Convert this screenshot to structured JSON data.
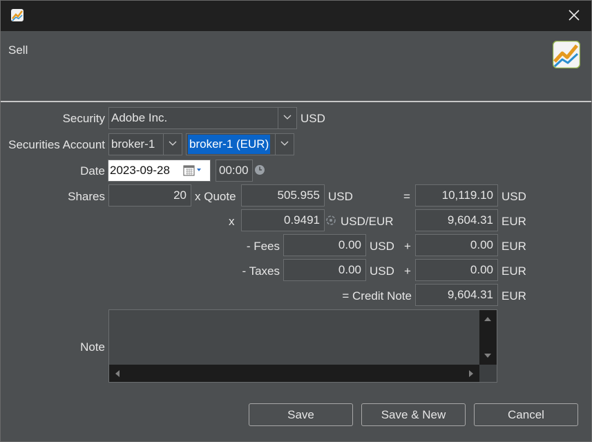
{
  "dialog": {
    "title": "Sell"
  },
  "form": {
    "security": {
      "label": "Security",
      "value": "Adobe Inc.",
      "currency": "USD"
    },
    "account": {
      "label": "Securities Account",
      "securities_value": "broker-1",
      "cash_value": "broker-1 (EUR)"
    },
    "date": {
      "label": "Date",
      "value": "2023-09-28",
      "time": "00:00"
    },
    "shares": {
      "label": "Shares",
      "value": "20"
    },
    "quote": {
      "label": "x Quote",
      "value": "505.955",
      "currency": "USD"
    },
    "gross": {
      "eq": "=",
      "value": "10,119.10",
      "currency": "USD"
    },
    "exchange": {
      "x": "x",
      "rate": "0.9491",
      "pair": "USD/EUR",
      "converted": "9,604.31",
      "currency": "EUR"
    },
    "fees": {
      "label": "- Fees",
      "value": "0.00",
      "currency": "USD",
      "plus": "+",
      "converted": "0.00",
      "converted_currency": "EUR"
    },
    "taxes": {
      "label": "- Taxes",
      "value": "0.00",
      "currency": "USD",
      "plus": "+",
      "converted": "0.00",
      "converted_currency": "EUR"
    },
    "total": {
      "label": "= Credit Note",
      "value": "9,604.31",
      "currency": "EUR"
    },
    "note": {
      "label": "Note",
      "value": ""
    }
  },
  "buttons": {
    "save": "Save",
    "save_new": "Save & New",
    "cancel": "Cancel"
  },
  "colors": {
    "background": "#4c4f51",
    "titlebar": "#202020",
    "selection": "#0a64c8"
  }
}
